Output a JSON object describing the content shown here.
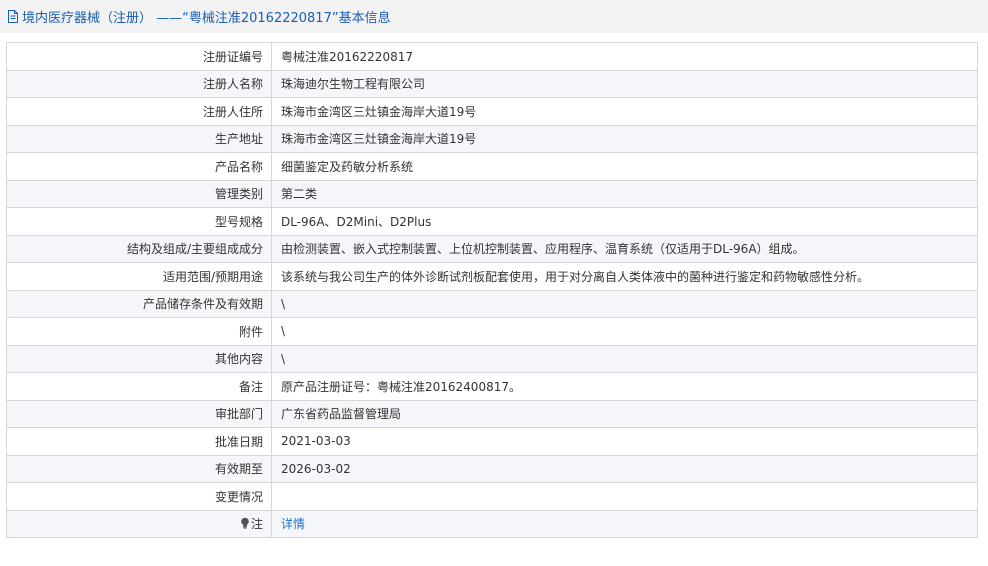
{
  "page": {
    "title": "境内医疗器械（注册） ——“粤械注准20162220817”基本信息"
  },
  "rows": [
    {
      "label": "注册证编号",
      "value": "粤械注准20162220817"
    },
    {
      "label": "注册人名称",
      "value": "珠海迪尔生物工程有限公司"
    },
    {
      "label": "注册人住所",
      "value": "珠海市金湾区三灶镇金海岸大道19号"
    },
    {
      "label": "生产地址",
      "value": "珠海市金湾区三灶镇金海岸大道19号"
    },
    {
      "label": "产品名称",
      "value": "细菌鉴定及药敏分析系统"
    },
    {
      "label": "管理类别",
      "value": "第二类"
    },
    {
      "label": "型号规格",
      "value": "DL-96A、D2Mini、D2Plus"
    },
    {
      "label": "结构及组成/主要组成成分",
      "value": "由检测装置、嵌入式控制装置、上位机控制装置、应用程序、温育系统（仅适用于DL-96A）组成。"
    },
    {
      "label": "适用范围/预期用途",
      "value": "该系统与我公司生产的体外诊断试剂板配套使用，用于对分离自人类体液中的菌种进行鉴定和药物敏感性分析。"
    },
    {
      "label": "产品储存条件及有效期",
      "value": "\\"
    },
    {
      "label": "附件",
      "value": "\\"
    },
    {
      "label": "其他内容",
      "value": "\\"
    },
    {
      "label": "备注",
      "value": "原产品注册证号：粤械注准20162400817。"
    },
    {
      "label": "审批部门",
      "value": "广东省药品监督管理局"
    },
    {
      "label": "批准日期",
      "value": "2021-03-03"
    },
    {
      "label": "有效期至",
      "value": "2026-03-02"
    },
    {
      "label": "变更情况",
      "value": ""
    }
  ],
  "note": {
    "icon": "lightbulb-icon",
    "label": "注",
    "link_text": "详情"
  },
  "colors": {
    "title": "#1a5fb4",
    "link": "#1a73c8",
    "border": "#d7d7d7",
    "alt_row": "#f5f6fa",
    "title_bg": "#f2f2f2"
  }
}
